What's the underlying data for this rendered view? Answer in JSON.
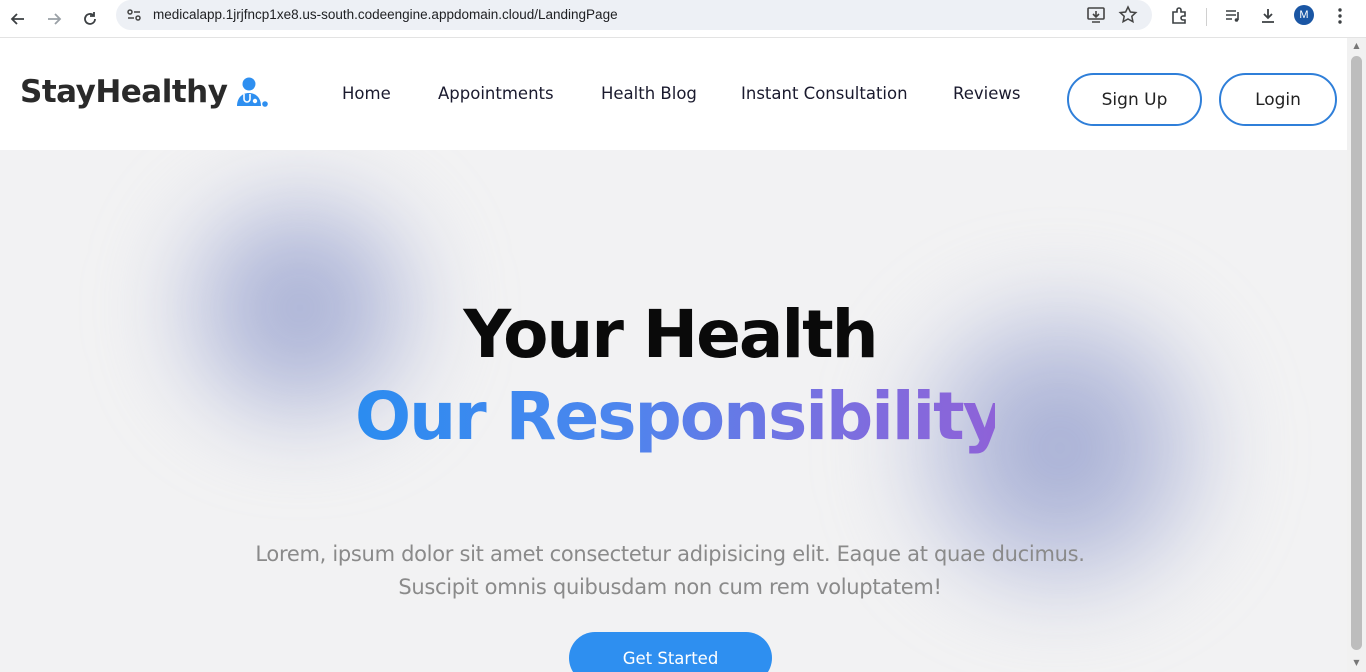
{
  "browser": {
    "url": "medicalapp.1jrjfncp1xe8.us-south.codeengine.appdomain.cloud/LandingPage",
    "profile_initial": "M"
  },
  "navbar": {
    "logo_text": "StayHealthy",
    "links": [
      "Home",
      "Appointments",
      "Health Blog",
      "Instant Consultation",
      "Reviews"
    ],
    "signup_label": "Sign Up",
    "login_label": "Login"
  },
  "hero": {
    "line1": "Your Health",
    "line2": "Our Responsibility",
    "description_line1": "Lorem, ipsum dolor sit amet consectetur adipisicing elit. Eaque at quae ducimus.",
    "description_line2": "Suscipit omnis quibusdam non cum rem voluptatem!",
    "cta_label": "Get Started"
  },
  "colors": {
    "accent_blue": "#2e8ff0",
    "gradient_start": "#2b8cf0",
    "gradient_end": "#8e62d8"
  }
}
